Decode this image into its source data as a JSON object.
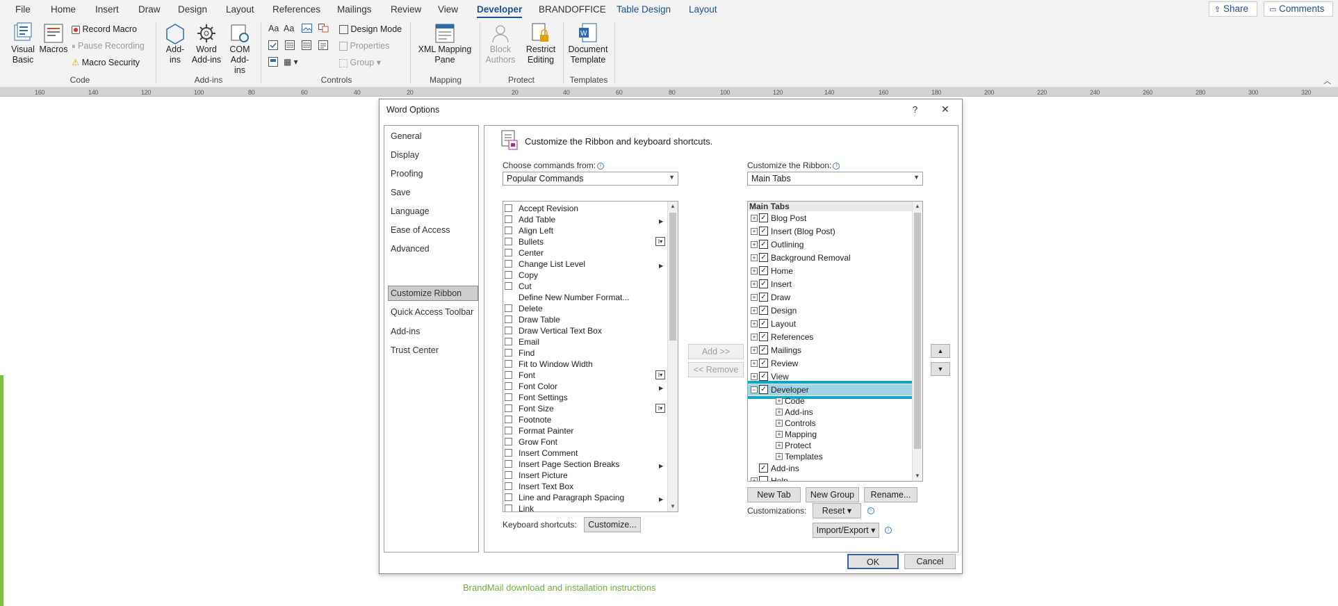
{
  "ribbon_tabs": [
    "File",
    "Home",
    "Insert",
    "Draw",
    "Design",
    "Layout",
    "References",
    "Mailings",
    "Review",
    "View",
    "Developer",
    "BRANDOFFICE",
    "Table Design",
    "Layout"
  ],
  "top_right": {
    "share": "Share",
    "comments": "Comments"
  },
  "ribbon": {
    "code": {
      "visual_basic": "Visual Basic",
      "macros": "Macros",
      "record_macro": "Record Macro",
      "pause_recording": "Pause Recording",
      "macro_security": "Macro Security",
      "group": "Code"
    },
    "addins": {
      "addins": "Add-ins",
      "word_addins": "Word Add-ins",
      "com_addins": "COM Add-ins",
      "group": "Add-ins"
    },
    "controls": {
      "design_mode": "Design Mode",
      "properties": "Properties",
      "group_btn": "Group",
      "group": "Controls"
    },
    "mapping": {
      "xml_mapping": "XML Mapping Pane",
      "group": "Mapping"
    },
    "protect": {
      "block_authors": "Block Authors",
      "restrict_editing": "Restrict Editing",
      "group": "Protect"
    },
    "templates": {
      "document_template": "Document Template",
      "group": "Templates"
    }
  },
  "ruler_ticks": [
    "160",
    "140",
    "120",
    "100",
    "80",
    "60",
    "40",
    "20",
    "20",
    "40",
    "60",
    "80",
    "100",
    "120",
    "140",
    "160",
    "180",
    "200",
    "220",
    "240",
    "260",
    "280",
    "300",
    "320"
  ],
  "dialog": {
    "title": "Word Options",
    "help": "?",
    "close": "✕",
    "nav": [
      "General",
      "Display",
      "Proofing",
      "Save",
      "Language",
      "Ease of Access",
      "Advanced",
      "Customize Ribbon",
      "Quick Access Toolbar",
      "Add-ins",
      "Trust Center"
    ],
    "header": "Customize the Ribbon and keyboard shortcuts.",
    "choose_label": "Choose commands from:",
    "choose_value": "Popular Commands",
    "customize_label": "Customize the Ribbon:",
    "customize_value": "Main Tabs",
    "commands": [
      "Accept Revision",
      "Add Table",
      "Align Left",
      "Bullets",
      "Center",
      "Change List Level",
      "Copy",
      "Cut",
      "Define New Number Format...",
      "Delete",
      "Draw Table",
      "Draw Vertical Text Box",
      "Email",
      "Find",
      "Fit to Window Width",
      "Font",
      "Font Color",
      "Font Settings",
      "Font Size",
      "Footnote",
      "Format Painter",
      "Grow Font",
      "Insert Comment",
      "Insert Page  Section Breaks",
      "Insert Picture",
      "Insert Text Box",
      "Line and Paragraph Spacing",
      "Link"
    ],
    "add_button": "Add >>",
    "remove_button": "<< Remove",
    "tree_header": "Main Tabs",
    "tree": [
      "Blog Post",
      "Insert (Blog Post)",
      "Outlining",
      "Background Removal",
      "Home",
      "Insert",
      "Draw",
      "Design",
      "Layout",
      "References",
      "Mailings",
      "Review",
      "View",
      "Developer"
    ],
    "developer_children": [
      "Code",
      "Add-ins",
      "Controls",
      "Mapping",
      "Protect",
      "Templates"
    ],
    "after_tree": [
      "Add-ins",
      "Help"
    ],
    "new_tab": "New Tab",
    "new_group": "New Group",
    "rename": "Rename...",
    "customizations_label": "Customizations:",
    "reset": "Reset",
    "import_export": "Import/Export",
    "keyboard_label": "Keyboard shortcuts:",
    "customize_btn": "Customize...",
    "ok": "OK",
    "cancel": "Cancel"
  },
  "footer_link": "BrandMail download and installation instructions",
  "colors": {
    "accent": "#1e4e94",
    "highlight": "#0ea5c9",
    "green": "#7ac143"
  }
}
